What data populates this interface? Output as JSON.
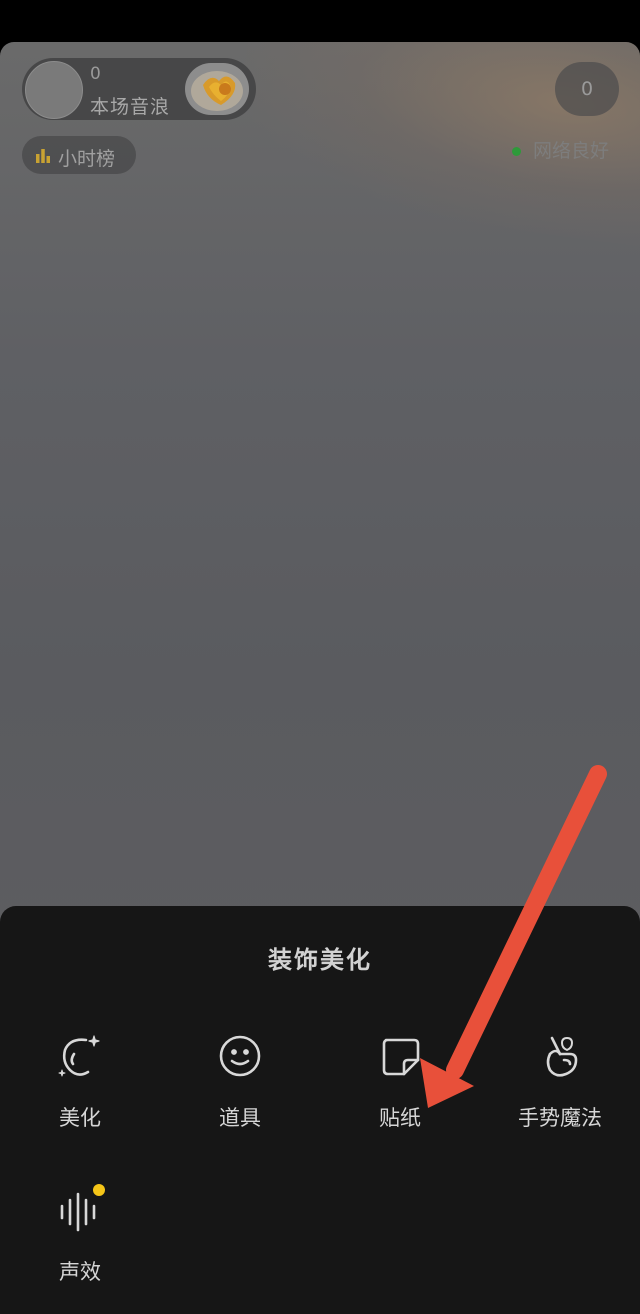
{
  "live": {
    "anchor": {
      "count": "0",
      "label": "本场音浪"
    },
    "viewer_count": "0",
    "rank": {
      "label": "小时榜",
      "icon": "bar-chart-icon"
    },
    "network_status": "网络良好",
    "network_color": "#2e9a3a"
  },
  "sheet": {
    "title": "装饰美化",
    "tools": [
      {
        "label": "美化",
        "icon": "face-sparkle-icon"
      },
      {
        "label": "道具",
        "icon": "smiley-icon"
      },
      {
        "label": "贴纸",
        "icon": "sticker-icon"
      },
      {
        "label": "手势魔法",
        "icon": "hand-gesture-icon"
      },
      {
        "label": "声效",
        "icon": "sound-wave-icon",
        "badge_color": "#f5c518"
      }
    ]
  },
  "annotation": {
    "arrow_color": "#e8503a"
  }
}
